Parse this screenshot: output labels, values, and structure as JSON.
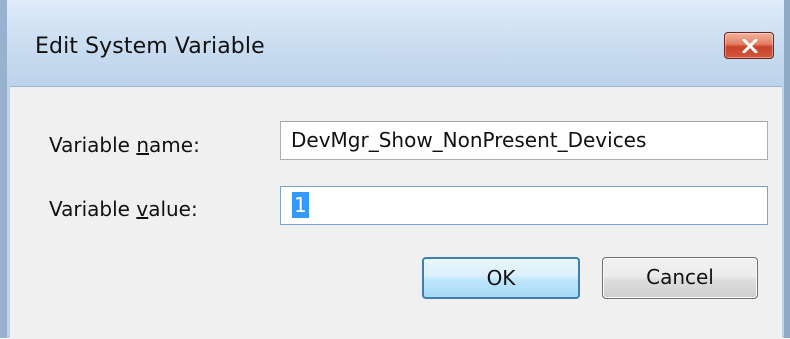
{
  "window": {
    "title": "Edit System Variable",
    "close_icon": "close-x-icon"
  },
  "fields": {
    "name": {
      "label_prefix": "Variable ",
      "label_accel": "n",
      "label_suffix": "ame:",
      "value": "DevMgr_Show_NonPresent_Devices"
    },
    "value": {
      "label_prefix": "Variable ",
      "label_accel": "v",
      "label_suffix": "alue:",
      "value": "1"
    }
  },
  "buttons": {
    "ok_label": "OK",
    "cancel_label": "Cancel"
  },
  "colors": {
    "close_button": "#d2593e",
    "selection": "#3399ff",
    "ok_border": "#3c7fb1"
  }
}
